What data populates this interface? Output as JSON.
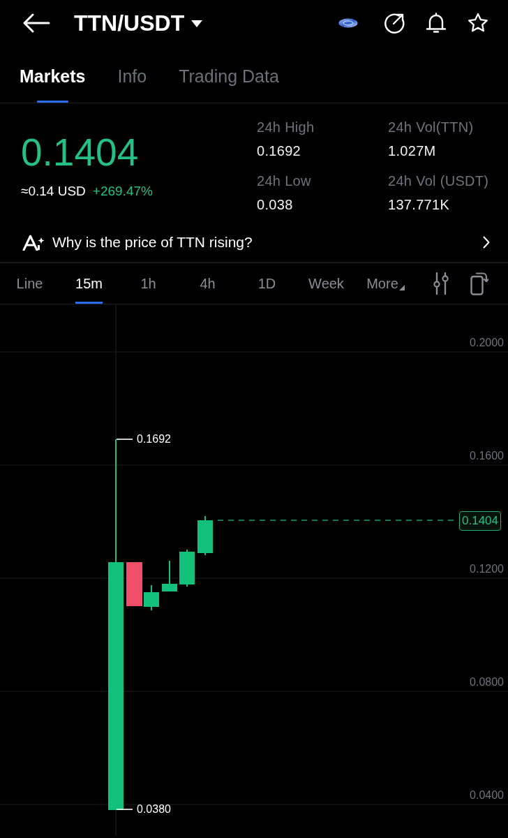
{
  "header": {
    "title": "TTN/USDT"
  },
  "tabs": [
    {
      "label": "Markets",
      "selected": true
    },
    {
      "label": "Info",
      "selected": false
    },
    {
      "label": "Trading Data",
      "selected": false
    }
  ],
  "ticker": {
    "price": "0.1404",
    "usd_value": "≈0.14 USD",
    "change": "+269.47%"
  },
  "stats": [
    {
      "label": "24h High",
      "value": "0.1692"
    },
    {
      "label": "24h Vol(TTN)",
      "value": "1.027M"
    },
    {
      "label": "24h Low",
      "value": "0.038"
    },
    {
      "label": "24h Vol (USDT)",
      "value": "137.771K"
    }
  ],
  "insight": {
    "text": "Why is the price of TTN rising?"
  },
  "intervals": [
    {
      "label": "Line",
      "kind": "option",
      "selected": false
    },
    {
      "label": "15m",
      "kind": "option",
      "selected": true
    },
    {
      "label": "1h",
      "kind": "option",
      "selected": false
    },
    {
      "label": "4h",
      "kind": "option",
      "selected": false
    },
    {
      "label": "1D",
      "kind": "option",
      "selected": false
    },
    {
      "label": "Week",
      "kind": "option",
      "selected": false
    },
    {
      "label": "More",
      "kind": "dropdown",
      "selected": false
    }
  ],
  "chart": {
    "y_axis_labels": [
      "0.2000",
      "0.1600",
      "0.1200",
      "0.0800",
      "0.0400"
    ],
    "high_label": "0.1692",
    "low_label": "0.0380",
    "last_price": "0.1404"
  }
}
